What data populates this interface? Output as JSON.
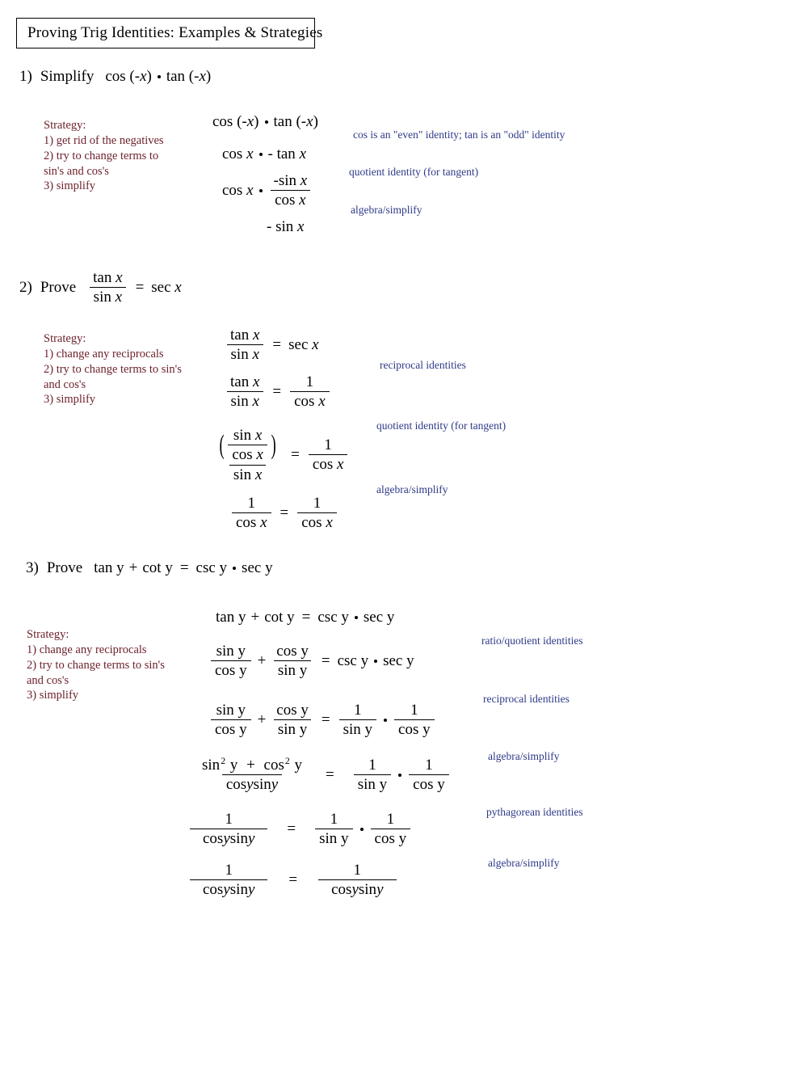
{
  "document": {
    "title": "Proving Trig Identities: Examples & Strategies"
  },
  "problems": [
    {
      "number": "1)",
      "verb": "Simplify",
      "statement": "cos (-x) · tan (-x)",
      "strategy": {
        "heading": "Strategy:",
        "steps": [
          "1) get rid of the negatives",
          "2) try to change terms to",
          "sin's and cos's",
          "3) simplify"
        ]
      },
      "steps": [
        "cos (-x) · tan (-x)",
        "cos x · - tan x",
        "cos x · -sin x / cos x",
        "- sin x"
      ],
      "annotations": [
        "cos is an \"even\" identity;  tan is an \"odd\" identity",
        "quotient identity (for tangent)",
        "algebra/simplify"
      ]
    },
    {
      "number": "2)",
      "verb": "Prove",
      "statement": "tan x / sin x = sec x",
      "strategy": {
        "heading": "Strategy:",
        "steps": [
          "1) change any reciprocals",
          "2) try to change terms to sin's",
          "and cos's",
          "3) simplify"
        ]
      },
      "steps": [
        "tan x / sin x = sec x",
        "tan x / sin x = 1 / cos x",
        "( sin x / cos x ) / sin x = 1 / cos x",
        "1 / cos x = 1 / cos x"
      ],
      "annotations": [
        "reciprocal identities",
        "quotient identity (for tangent)",
        "algebra/simplify"
      ]
    },
    {
      "number": "3)",
      "verb": "Prove",
      "statement": "tan y + cot y =  csc y · sec y",
      "strategy": {
        "heading": "Strategy:",
        "steps": [
          "1) change any reciprocals",
          "2) try to change terms to sin's",
          "and cos's",
          "3) simplify"
        ]
      },
      "steps": [
        "tan y + cot y =  csc y · sec y",
        "sin y / cos y + cos y / sin y = csc y · sec y",
        "sin y / cos y + cos y / sin y = 1 / sin y · 1 / cos y",
        "sin² y + cos² y / cosysiny = 1 / sin y · 1 / cos y",
        "1 / cosysiny = 1 / sin y · 1 / cos y",
        "1 / cosysiny = 1 / cosysiny"
      ],
      "annotations": [
        "ratio/quotient identities",
        "reciprocal identities",
        "algebra/simplify",
        "pythagorean identities",
        "algebra/simplify"
      ]
    }
  ],
  "tokens": {
    "cos": "cos",
    "sin": "sin",
    "tan": "tan",
    "sec": "sec",
    "csc": "csc",
    "cot": "cot",
    "x": "x",
    "y": "y",
    "one": "1",
    "two": "2",
    "eq": "=",
    "plus": "+",
    "minus": "-",
    "neg_sin": "-sin",
    "minus_tan": "- tan",
    "minus_sin": "- sin",
    "cos_negx": "cos (-",
    "close_paren": ")",
    "tan_negx": "tan (-",
    "cosysiny": "cosysiny"
  },
  "colors": {
    "strategy": "#6b1f2a",
    "annotation": "#2e3a87",
    "text": "#000000",
    "border": "#000000",
    "background": "#ffffff"
  }
}
